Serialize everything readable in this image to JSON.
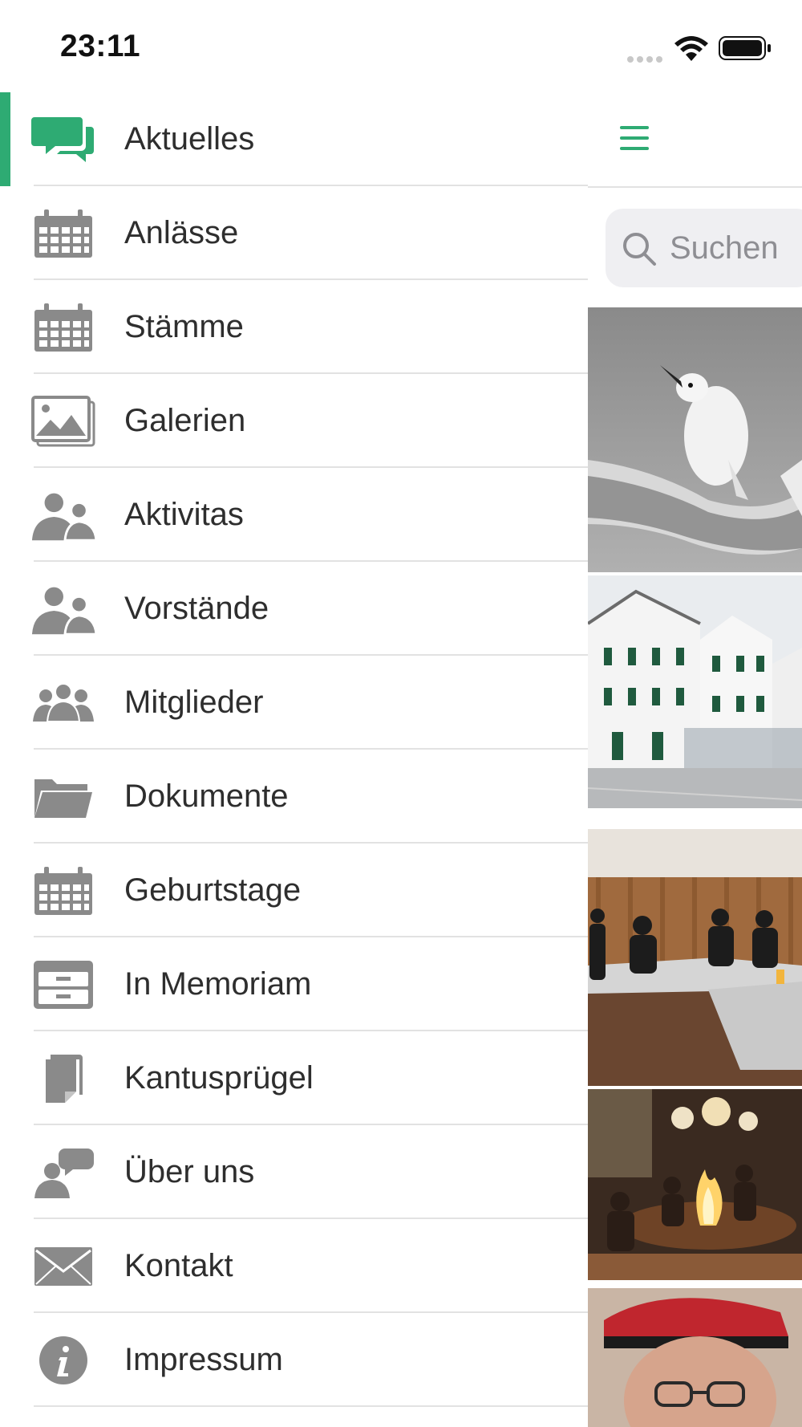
{
  "status_bar": {
    "time": "23:11"
  },
  "menu": {
    "items": [
      {
        "label": "Aktuelles",
        "icon": "chat-bubbles-icon",
        "active": true
      },
      {
        "label": "Anlässe",
        "icon": "calendar-icon"
      },
      {
        "label": "Stämme",
        "icon": "calendar-icon"
      },
      {
        "label": "Galerien",
        "icon": "image-gallery-icon"
      },
      {
        "label": "Aktivitas",
        "icon": "two-people-icon"
      },
      {
        "label": "Vorstände",
        "icon": "two-people-icon"
      },
      {
        "label": "Mitglieder",
        "icon": "group-icon"
      },
      {
        "label": "Dokumente",
        "icon": "folder-icon"
      },
      {
        "label": "Geburtstage",
        "icon": "calendar-icon"
      },
      {
        "label": "In Memoriam",
        "icon": "archive-drawer-icon"
      },
      {
        "label": "Kantusprügel",
        "icon": "document-icon"
      },
      {
        "label": "Über uns",
        "icon": "person-speech-icon"
      },
      {
        "label": "Kontakt",
        "icon": "envelope-icon"
      },
      {
        "label": "Impressum",
        "icon": "info-icon"
      }
    ]
  },
  "content": {
    "search": {
      "placeholder": "Suchen"
    },
    "feed_images": [
      "bird-photo",
      "building-photo",
      "meeting-photo",
      "fire-photo",
      "portrait-photo"
    ]
  },
  "colors": {
    "accent": "#2eab73",
    "icon_gray": "#8a8a8a",
    "divider": "#e2e2e2"
  }
}
